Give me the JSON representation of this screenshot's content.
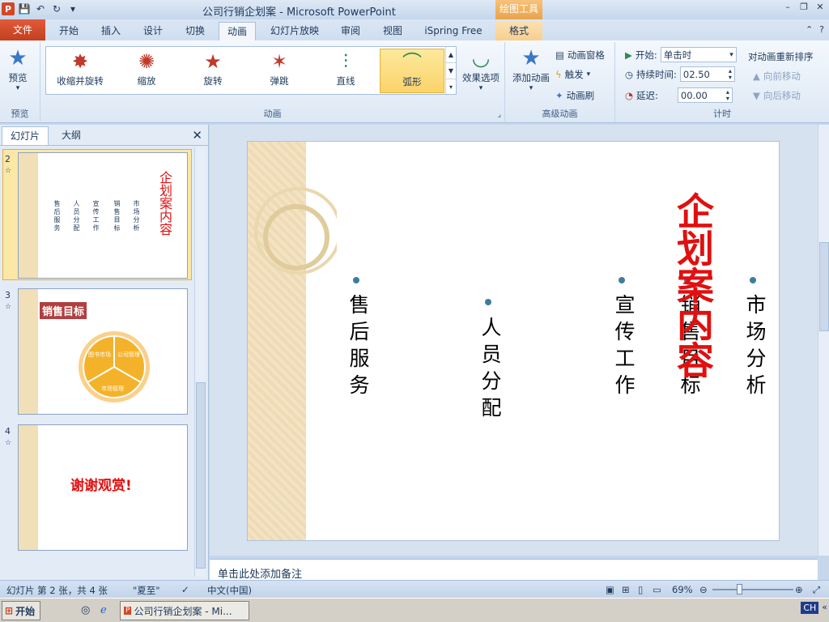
{
  "window": {
    "title": "公司行销企划案 - Microsoft PowerPoint",
    "contextual_tab_band": "绘图工具"
  },
  "tabs": [
    {
      "label": "文件"
    },
    {
      "label": "开始"
    },
    {
      "label": "插入"
    },
    {
      "label": "设计"
    },
    {
      "label": "切换"
    },
    {
      "label": "动画"
    },
    {
      "label": "幻灯片放映"
    },
    {
      "label": "审阅"
    },
    {
      "label": "视图"
    },
    {
      "label": "iSpring Free"
    },
    {
      "label": "格式"
    }
  ],
  "ribbon": {
    "preview": {
      "button": "预览",
      "group": "预览"
    },
    "animation_gallery": [
      {
        "label": "收缩并旋转"
      },
      {
        "label": "缩放"
      },
      {
        "label": "旋转"
      },
      {
        "label": "弹跳"
      },
      {
        "label": "直线"
      },
      {
        "label": "弧形"
      }
    ],
    "effect_options": "效果选项",
    "animation_group": "动画",
    "advanced": {
      "add_animation": "添加动画",
      "animation_pane": "动画窗格",
      "trigger": "触发",
      "animation_painter": "动画刷",
      "group": "高级动画"
    },
    "timing": {
      "start_label": "开始:",
      "start_value": "单击时",
      "duration_label": "持续时间:",
      "duration_value": "02.50",
      "delay_label": "延迟:",
      "delay_value": "00.00",
      "reorder_title": "对动画重新排序",
      "move_earlier": "向前移动",
      "move_later": "向后移动",
      "group": "计时"
    }
  },
  "left_pane": {
    "tab_slides": "幻灯片",
    "tab_outline": "大纲",
    "thumbnails": [
      {
        "number": "2",
        "title": "企划案内容",
        "columns": [
          "售后服务",
          "人员分配",
          "宣传工作",
          "销售目标",
          "市场分析"
        ]
      },
      {
        "number": "3",
        "title": "销售目标",
        "segments": [
          "图书市场",
          "公司管理",
          "市场管理"
        ]
      },
      {
        "number": "4",
        "text": "谢谢观赏!"
      }
    ]
  },
  "slide": {
    "title": "企划案内容",
    "columns": [
      "售后服务",
      "人员分配",
      "宣传工作",
      "销售目标",
      "市场分析"
    ]
  },
  "notes": {
    "placeholder": "单击此处添加备注"
  },
  "status": {
    "slide_info": "幻灯片 第 2 张，共 4 张",
    "theme": "\"夏至\"",
    "language": "中文(中国)",
    "zoom": "69%"
  },
  "taskbar": {
    "start": "开始",
    "task_item": "公司行销企划案 - Mi...",
    "tray_lang": "CH"
  },
  "colors": {
    "accent_red": "#e01010",
    "file_tab": "#c2401f",
    "selected_gallery": "#fbd36a",
    "bullet": "#3d7d9c"
  }
}
